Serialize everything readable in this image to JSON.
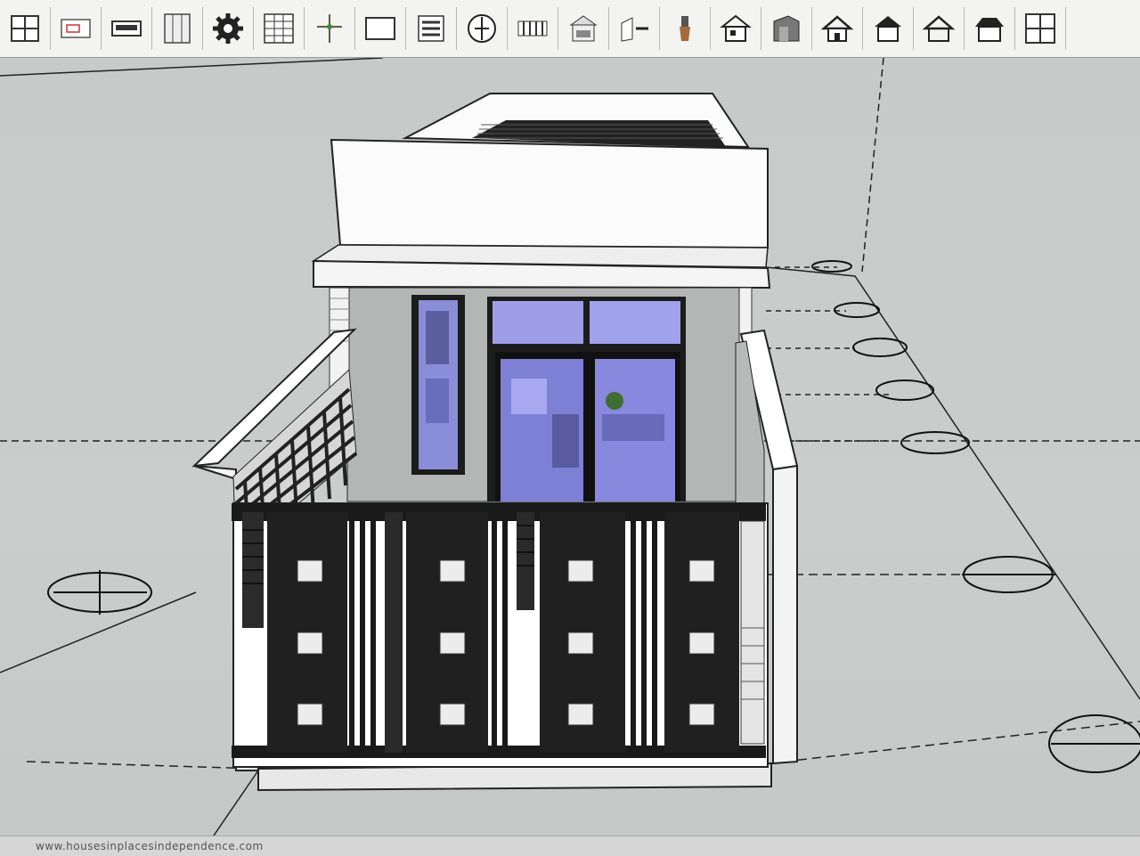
{
  "app": {
    "type": "3d-modeling",
    "accent": "#1a1a1a",
    "background": "#c9cbcb"
  },
  "toolbar": {
    "tools": [
      {
        "icon": "window-grid-icon"
      },
      {
        "icon": "window-sash-icon"
      },
      {
        "icon": "window-slider-icon"
      },
      {
        "icon": "door-panel-icon"
      },
      {
        "icon": "gear-icon"
      },
      {
        "icon": "grid-panel-icon"
      },
      {
        "icon": "figure-icon"
      },
      {
        "icon": "rectangle-icon"
      },
      {
        "icon": "stacked-lines-icon"
      },
      {
        "icon": "axis-crosshair-icon"
      },
      {
        "icon": "fence-icon"
      },
      {
        "icon": "roof-panel-icon"
      },
      {
        "icon": "wall-extrude-icon"
      },
      {
        "icon": "brush-icon"
      },
      {
        "icon": "house-window-icon"
      },
      {
        "icon": "house-shed-icon"
      },
      {
        "icon": "house-gable-icon"
      },
      {
        "icon": "house-dark-roof-icon"
      },
      {
        "icon": "house-outline-icon"
      },
      {
        "icon": "house-hip-roof-icon"
      },
      {
        "icon": "grid-2x2-icon"
      }
    ]
  },
  "status": {
    "text": "www.housesinplacesindependence.com"
  }
}
